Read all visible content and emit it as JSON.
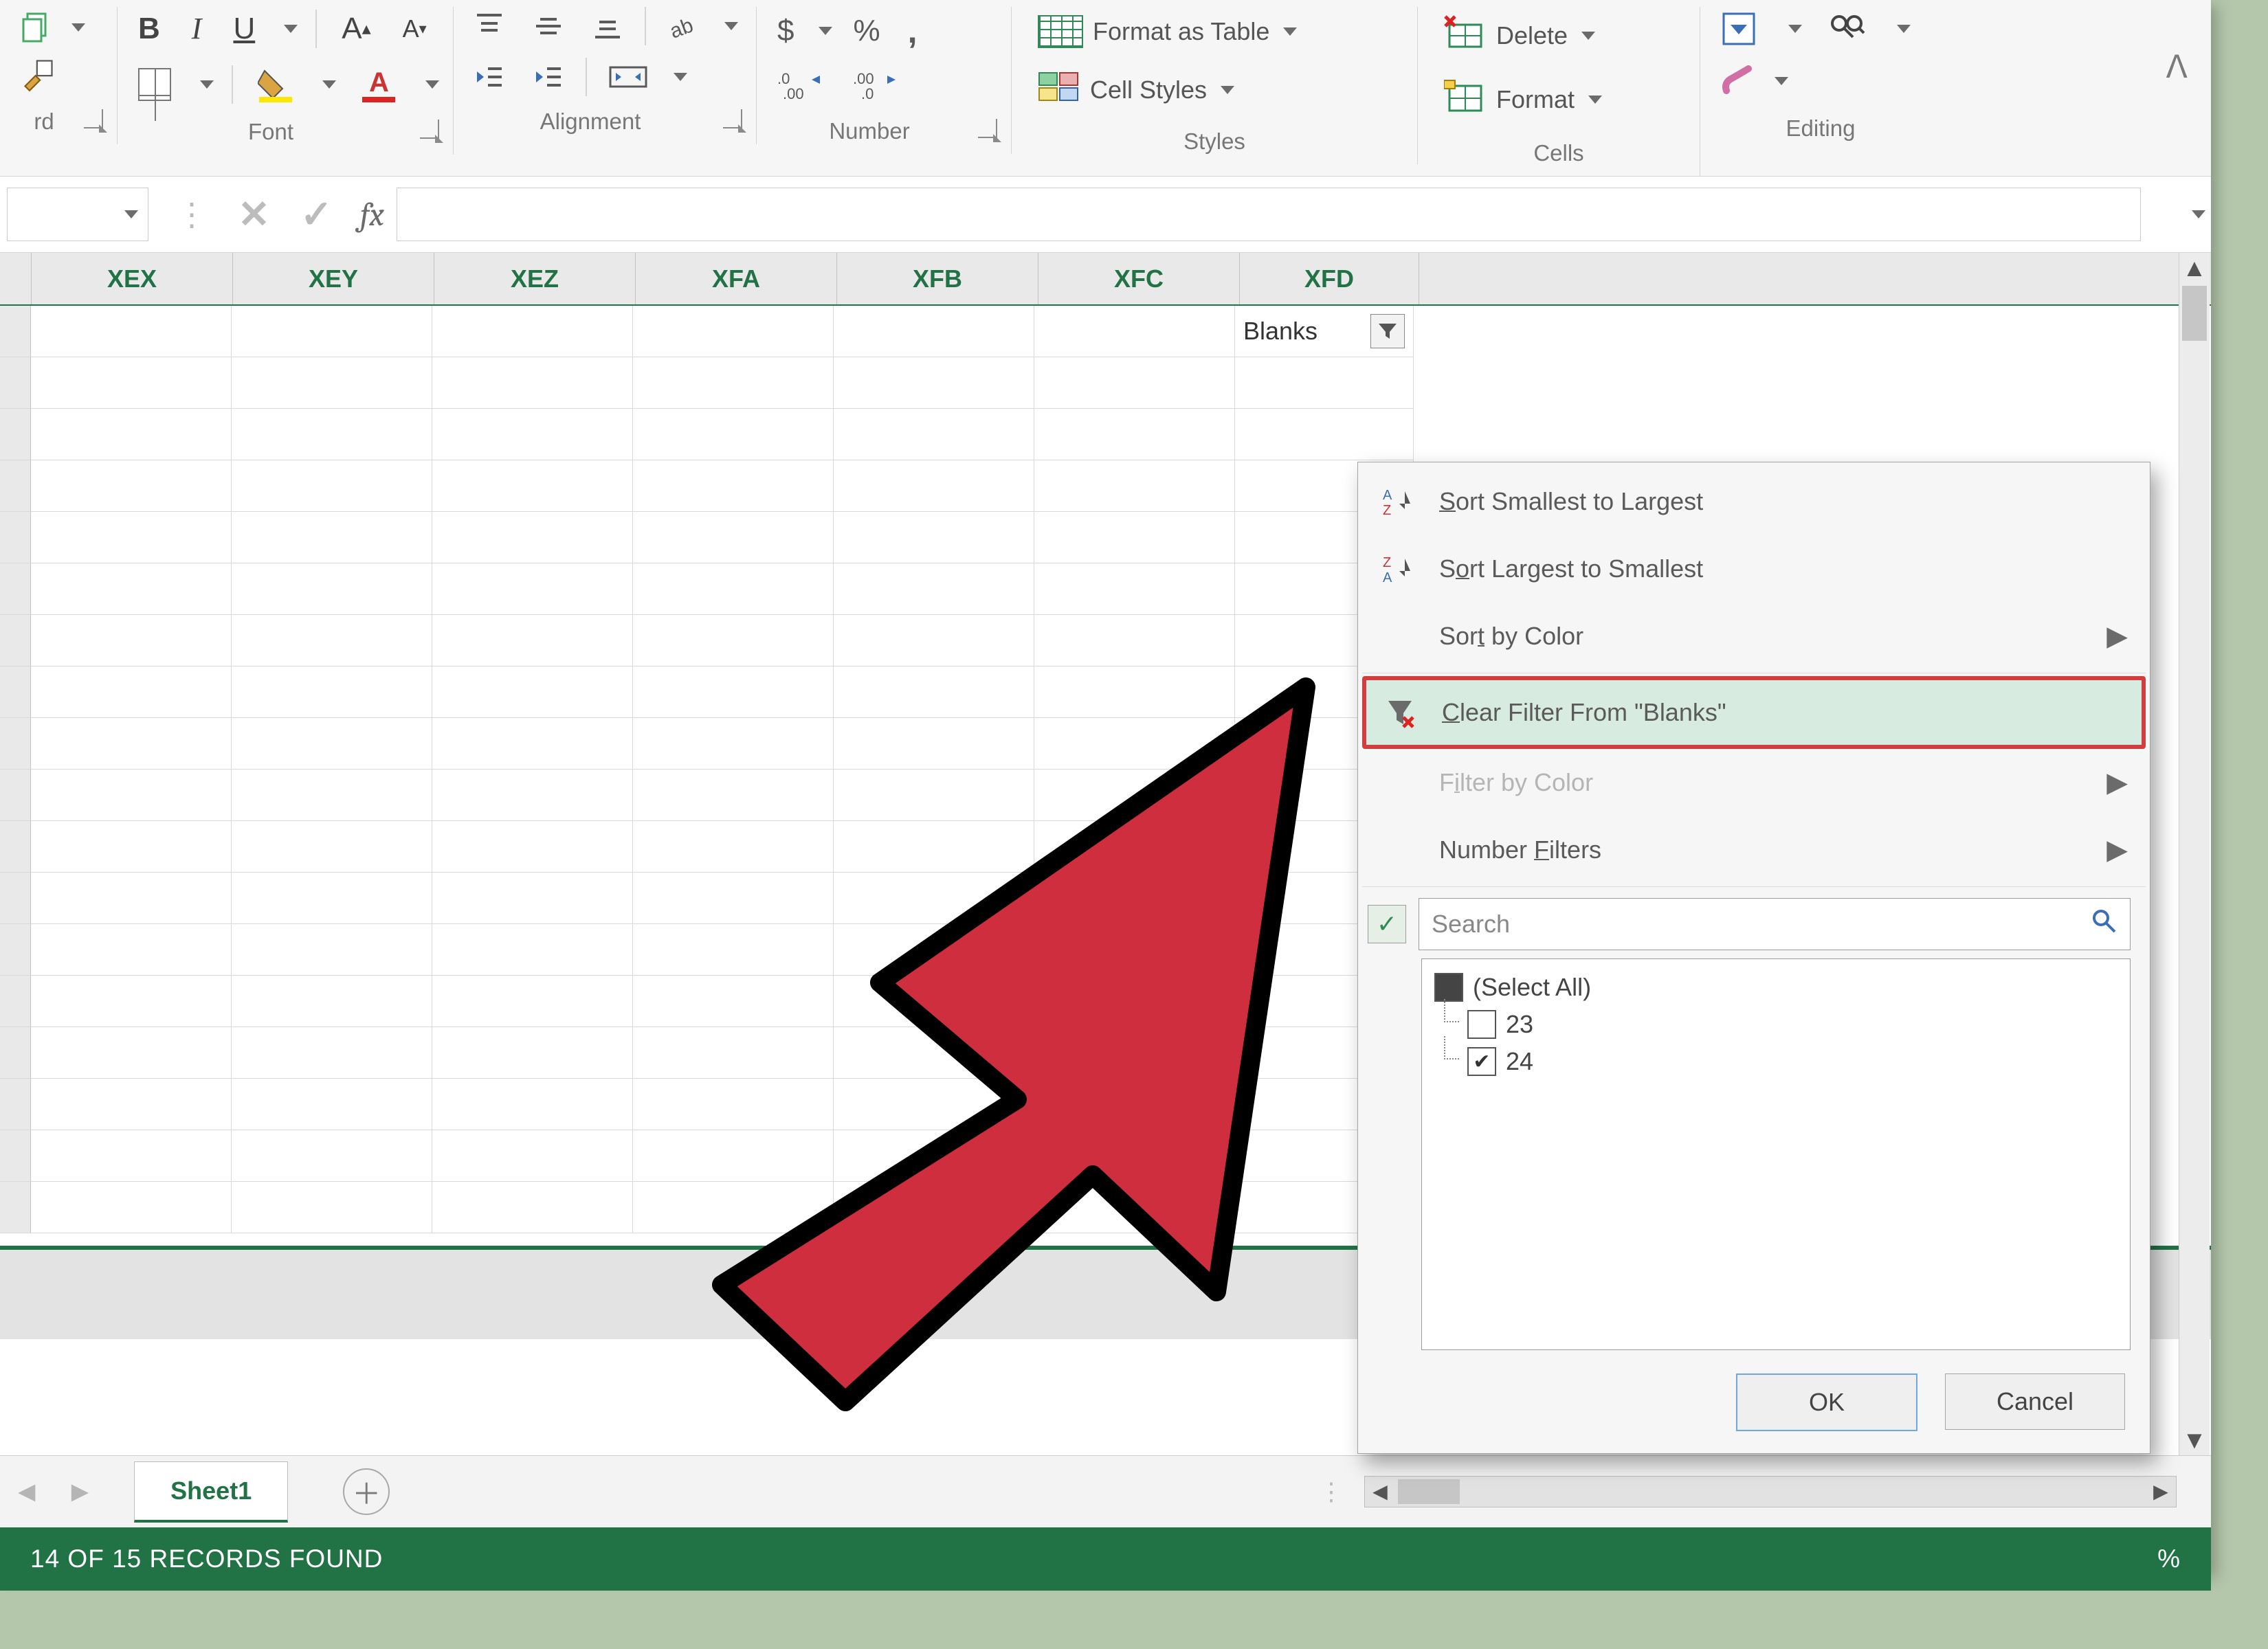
{
  "ribbon": {
    "groups": {
      "clipboard": {
        "label": "rd"
      },
      "font": {
        "label": "Font",
        "bold": "B",
        "italic": "I",
        "underline": "U"
      },
      "alignment": {
        "label": "Alignment"
      },
      "number": {
        "label": "Number",
        "currency": "$",
        "percent": "%",
        "comma": ",",
        "inc": ".0←",
        "dec": ".00→"
      },
      "styles": {
        "label": "Styles",
        "format_table": "Format as Table",
        "cell_styles": "Cell Styles"
      },
      "cells": {
        "label": "Cells",
        "delete": "Delete",
        "format": "Format"
      },
      "editing": {
        "label": "Editing"
      }
    }
  },
  "formula_bar": {
    "fx": "fx"
  },
  "columns": [
    "XEX",
    "XEY",
    "XEZ",
    "XFA",
    "XFB",
    "XFC",
    "XFD"
  ],
  "first_cell_label": "Blanks",
  "filter_menu": {
    "sort_asc": "Sort Smallest to Largest",
    "sort_desc": "Sort Largest to Smallest",
    "sort_color": "Sort by Color",
    "clear_filter": "Clear Filter From \"Blanks\"",
    "filter_color": "Filter by Color",
    "number_filters": "Number Filters",
    "search_placeholder": "Search",
    "select_all": "(Select All)",
    "items": [
      {
        "label": "23",
        "checked": false
      },
      {
        "label": "24",
        "checked": true
      }
    ],
    "ok": "OK",
    "cancel": "Cancel"
  },
  "sheet_tab": "Sheet1",
  "status_text": "14 OF 15 RECORDS FOUND",
  "zoom": "%"
}
